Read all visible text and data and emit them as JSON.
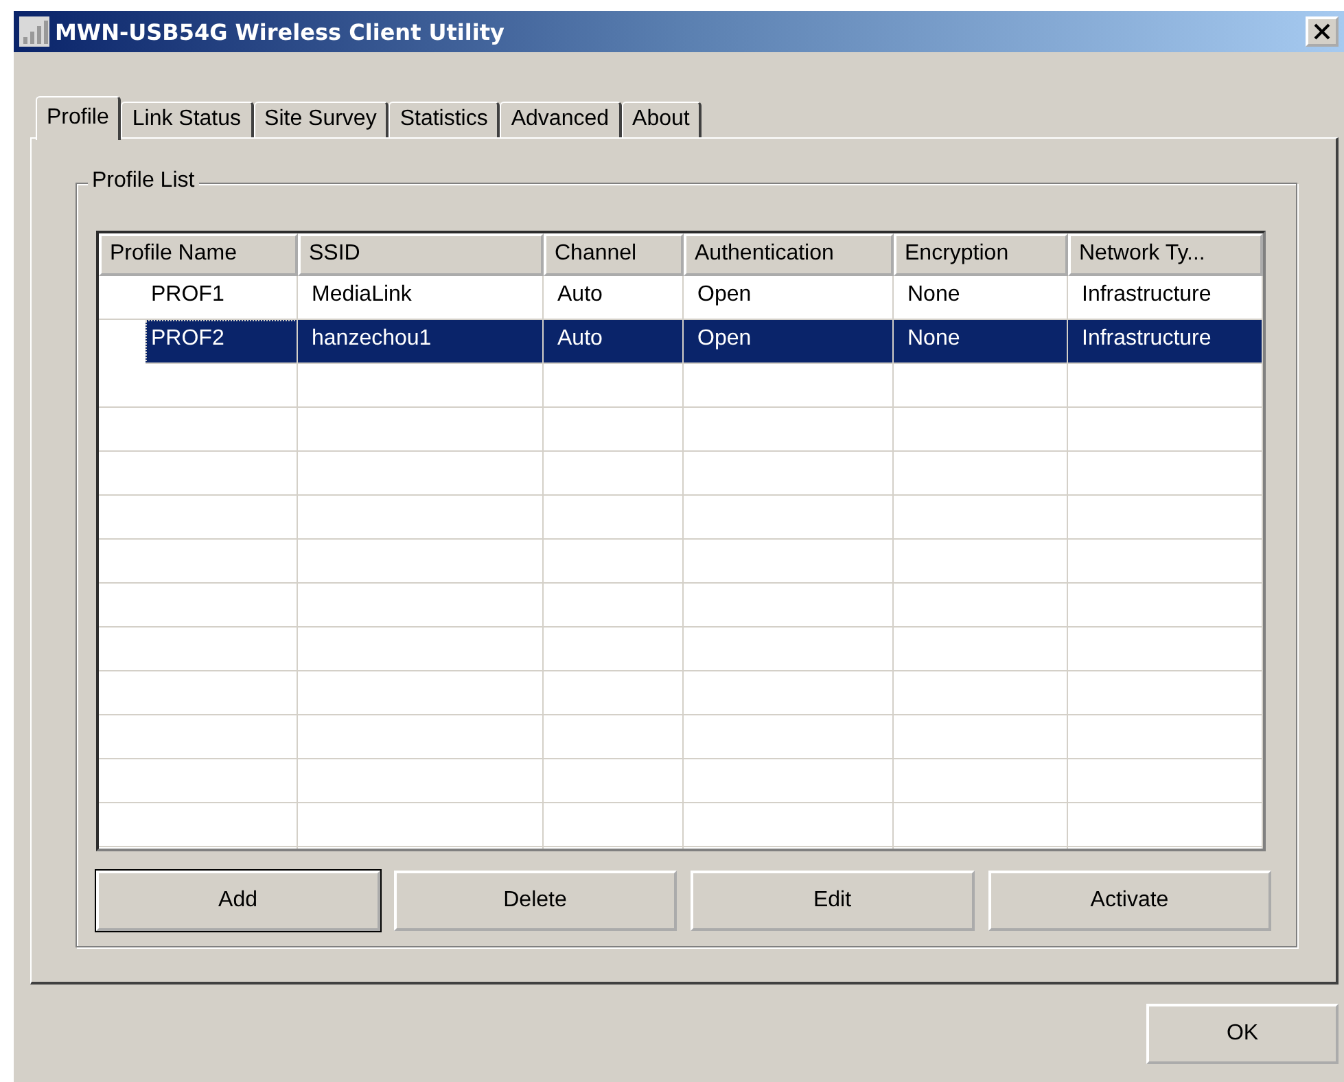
{
  "window": {
    "title": "MWN-USB54G Wireless Client Utility"
  },
  "tabs": [
    {
      "label": "Profile",
      "selected": true
    },
    {
      "label": "Link Status",
      "selected": false
    },
    {
      "label": "Site Survey",
      "selected": false
    },
    {
      "label": "Statistics",
      "selected": false
    },
    {
      "label": "Advanced",
      "selected": false
    },
    {
      "label": "About",
      "selected": false
    }
  ],
  "profile_list": {
    "title": "Profile List",
    "table": {
      "columns": [
        "Profile Name",
        "SSID",
        "Channel",
        "Authentication",
        "Encryption",
        "Network Ty..."
      ],
      "rows": [
        {
          "cells": [
            "PROF1",
            "MediaLink",
            "Auto",
            "Open",
            "None",
            "Infrastructure"
          ],
          "selected": false
        },
        {
          "cells": [
            "PROF2",
            "hanzechou1",
            "Auto",
            "Open",
            "None",
            "Infrastructure"
          ],
          "selected": true
        }
      ]
    },
    "buttons": [
      {
        "label": "Add",
        "default": true
      },
      {
        "label": "Delete",
        "default": false
      },
      {
        "label": "Edit",
        "default": false
      },
      {
        "label": "Activate",
        "default": false
      }
    ]
  },
  "ok_button": "OK"
}
